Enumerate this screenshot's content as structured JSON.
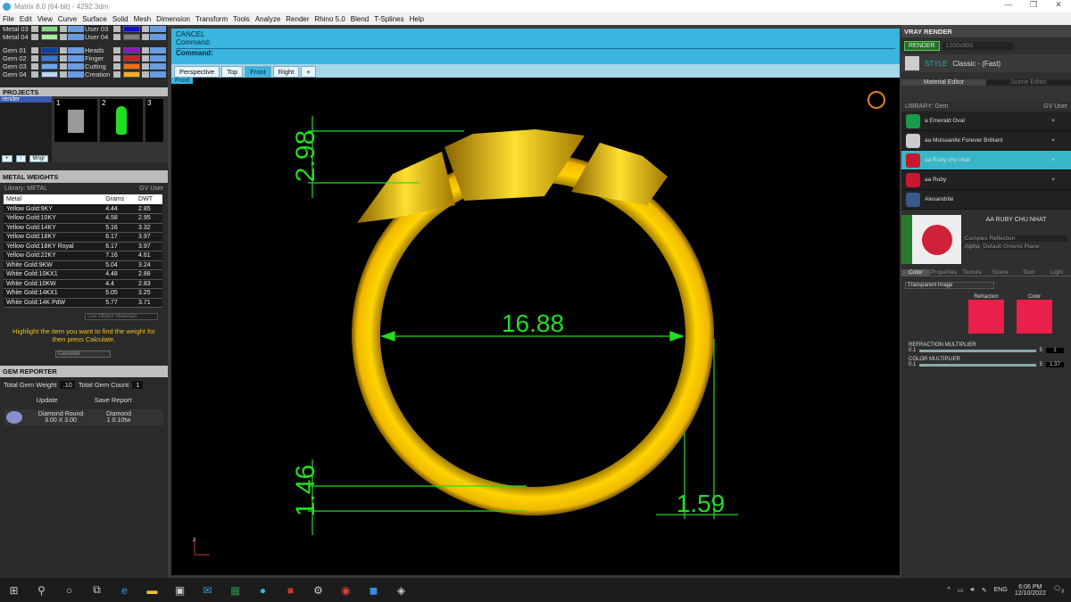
{
  "window": {
    "title": "Matrix 8.0 (64-bit) - 4292.3dm",
    "controls": [
      "—",
      "❐",
      "✕"
    ]
  },
  "menu": [
    "File",
    "Edit",
    "View",
    "Curve",
    "Surface",
    "Solid",
    "Mesh",
    "Dimension",
    "Transform",
    "Tools",
    "Analyze",
    "Render",
    "Rhino 5.0",
    "Blend",
    "T-Splines",
    "Help"
  ],
  "layers": {
    "left": [
      {
        "name": "Metal 03",
        "color": "#7ddc7d"
      },
      {
        "name": "Metal 04",
        "color": "#a8f0a0"
      },
      {
        "name": "Gem 01",
        "color": "#0b3ea8"
      },
      {
        "name": "Gem 02",
        "color": "#3a78d8"
      },
      {
        "name": "Gem 03",
        "color": "#6aa8f0"
      },
      {
        "name": "Gem 04",
        "color": "#b8d8f8"
      }
    ],
    "right": [
      {
        "name": "User 03",
        "color": "#1010d0"
      },
      {
        "name": "User 04",
        "color": "#808080"
      },
      {
        "name": "Heads",
        "color": "#8a1cb8"
      },
      {
        "name": "Finger",
        "color": "#c02828"
      },
      {
        "name": "Cutting",
        "color": "#f07010"
      },
      {
        "name": "Creation",
        "color": "#f8b020"
      }
    ]
  },
  "projects": {
    "title": "PROJECTS",
    "list": [
      "render"
    ],
    "thumbs": [
      "1",
      "2",
      "3"
    ],
    "buttons": [
      "+",
      "↑",
      "Mngr"
    ]
  },
  "metal_weights": {
    "title": "METAL WEIGHTS",
    "library": "Library: METAL",
    "gv": "GV",
    "user": "User",
    "columns": [
      "Metal",
      "Grams",
      "DWT"
    ],
    "rows": [
      [
        "Yellow Gold:9KY",
        "4.44",
        "2.85"
      ],
      [
        "Yellow Gold:10KY",
        "4.58",
        "2.95"
      ],
      [
        "Yellow Gold:14KY",
        "5.16",
        "3.32"
      ],
      [
        "Yellow Gold:18KY",
        "6.17",
        "3.97"
      ],
      [
        "Yellow Gold:18KY Royal",
        "6.17",
        "3.97"
      ],
      [
        "Yellow Gold:22KY",
        "7.16",
        "4.61"
      ],
      [
        "White Gold:9KW",
        "5.04",
        "3.24"
      ],
      [
        "White Gold:10KX1",
        "4.48",
        "2.88"
      ],
      [
        "White Gold:10KW",
        "4.4",
        "2.83"
      ],
      [
        "White Gold:14KX1",
        "5.05",
        "3.25"
      ],
      [
        "White Gold:14K PdW",
        "5.77",
        "3.71"
      ]
    ],
    "use_object_materials": "Use Object Materials",
    "hint": "Highlight the item you want to find the weight for then press Calculate.",
    "calculate": "Calculate"
  },
  "gem_reporter": {
    "title": "GEM REPORTER",
    "total_weight_label": "Total Gem Weight",
    "total_weight": ".10",
    "total_count_label": "Total Gem Count",
    "total_count": "1",
    "update": "Update",
    "save_report": "Save Report",
    "gem": {
      "shape": "Diamond Round",
      "size": "3.00 X 3.00",
      "type": "Diamond",
      "qty": "1",
      "tw": "0.10tw"
    }
  },
  "command": {
    "line1": "CANCEL",
    "line2": "Command:",
    "prompt": "Command:"
  },
  "view_tabs": [
    "Perspective",
    "Top",
    "Front",
    "Right",
    "+"
  ],
  "active_view": "Front",
  "viewport": {
    "label": "Front",
    "dims": {
      "top_height": "2.98",
      "inner_diameter": "16.88",
      "bottom_thickness": "1.46",
      "shank_width": "1.59"
    },
    "dim_color": "#22dd22",
    "metal_color": "#f5c400",
    "axis": "z"
  },
  "vray": {
    "title": "VRAY RENDER",
    "render": "RENDER",
    "resolution": "1200x900",
    "style_label": "STYLE",
    "style": "Classic - (Fast)",
    "tabs": [
      "Material Editor",
      "Scene Editor"
    ],
    "library": "LIBRARY: Gem",
    "gv": "GV",
    "user": "User",
    "materials": [
      {
        "name": "a Emerald Oval",
        "color": "#1a9a4a"
      },
      {
        "name": "aa Moissanite Forever Brilliant",
        "color": "#cccccc"
      },
      {
        "name": "aa Ruby chu nhat",
        "color": "#c81830",
        "selected": true
      },
      {
        "name": "aa Ruby",
        "color": "#c81830"
      },
      {
        "name": "Alexandrite",
        "color": "#3a5a8a"
      }
    ],
    "selected_name": "AA RUBY CHU NHAT",
    "reflection": "Complex Reflection",
    "alpha": "Alpha",
    "ground": "Default Ground Plane",
    "prop_tabs": [
      "Color",
      "Properties",
      "Texture",
      "Scene",
      "Toon",
      "Light"
    ],
    "mode": "Transparent Image",
    "swatches": [
      "Refraction",
      "Color"
    ],
    "refraction_multiplier": {
      "label": "REFRACTION MULTIPLIER",
      "min": "0.1",
      "max": "5",
      "value": "1"
    },
    "color_multiplier": {
      "label": "COLOR MULTIPLIER",
      "min": "0.1",
      "max": "5",
      "value": "1.37"
    }
  },
  "taskbar": {
    "lang": "ENG",
    "time": "6:06 PM",
    "date": "12/10/2022",
    "notifications": "3"
  }
}
